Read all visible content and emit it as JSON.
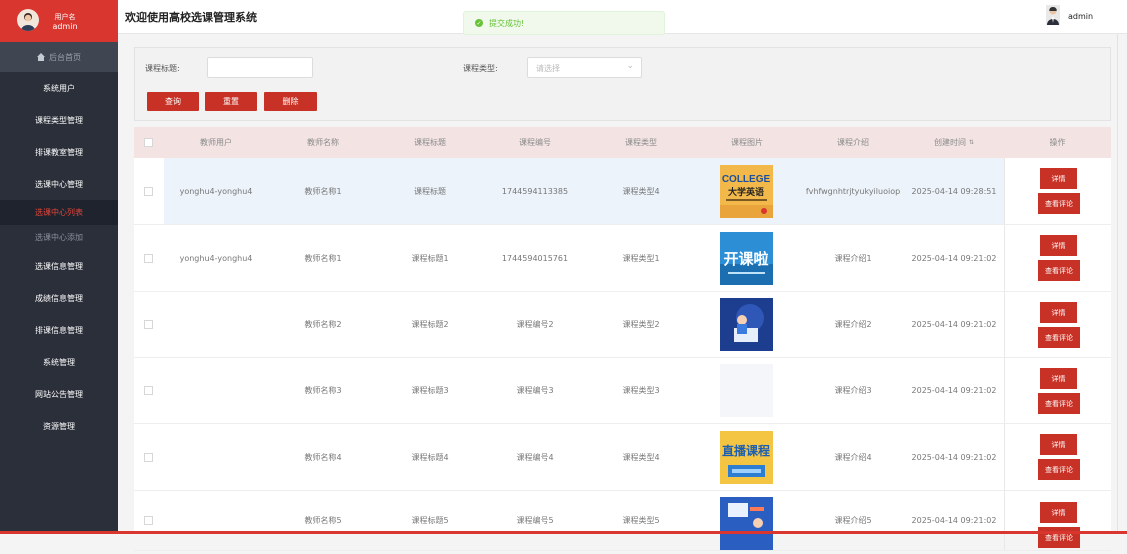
{
  "header": {
    "title": "欢迎使用高校选课管理系统",
    "user": "admin",
    "toast": "提交成功!"
  },
  "sidebar": {
    "role": "用户名",
    "user": "admin",
    "home": "后台首页",
    "items": [
      "系统用户",
      "课程类型管理",
      "排课教室管理",
      "选课中心管理",
      "选课中心列表",
      "选课中心添加",
      "选课信息管理",
      "成绩信息管理",
      "排课信息管理",
      "系统管理",
      "网站公告管理",
      "资源管理"
    ]
  },
  "search": {
    "title_label": "课程标题:",
    "type_label": "课程类型:",
    "type_placeholder": "请选择",
    "query": "查询",
    "reset": "重置",
    "delete": "删除"
  },
  "table": {
    "headers": [
      "教师用户",
      "教师名称",
      "课程标题",
      "课程编号",
      "课程类型",
      "课程图片",
      "课程介绍",
      "创建时间",
      "操作"
    ],
    "rows": [
      {
        "user": "yonghu4-yonghu4",
        "name": "教师名称1",
        "title": "课程标题",
        "code": "1744594113385",
        "type": "课程类型4",
        "intro": "fvhfwgnhtrjtyukyiluoiop",
        "time": "2025-04-14 09:28:51",
        "img": "english"
      },
      {
        "user": "yonghu4-yonghu4",
        "name": "教师名称1",
        "title": "课程标题1",
        "code": "1744594015761",
        "type": "课程类型1",
        "intro": "课程介绍1",
        "time": "2025-04-14 09:21:02",
        "img": "course"
      },
      {
        "user": "",
        "name": "教师名称2",
        "title": "课程标题2",
        "code": "课程编号2",
        "type": "课程类型2",
        "intro": "课程介绍2",
        "time": "2025-04-14 09:21:02",
        "img": "study"
      },
      {
        "user": "",
        "name": "教师名称3",
        "title": "课程标题3",
        "code": "课程编号3",
        "type": "课程类型3",
        "intro": "课程介绍3",
        "time": "2025-04-14 09:21:02",
        "img": "blank"
      },
      {
        "user": "",
        "name": "教师名称4",
        "title": "课程标题4",
        "code": "课程编号4",
        "type": "课程类型4",
        "intro": "课程介绍4",
        "time": "2025-04-14 09:21:02",
        "img": "live"
      },
      {
        "user": "",
        "name": "教师名称5",
        "title": "课程标题5",
        "code": "课程编号5",
        "type": "课程类型5",
        "intro": "课程介绍5",
        "time": "2025-04-14 09:21:02",
        "img": "online"
      }
    ],
    "detail": "详情",
    "comment": "查看评论"
  },
  "images": {
    "english": {
      "line1": "COLLEGE",
      "line2": "大学英语"
    },
    "course": {
      "text": "开课啦"
    },
    "live": {
      "line1": "直播课程"
    }
  },
  "colors": {
    "accent": "#d9362f",
    "sidebar": "#2b2f3a"
  }
}
